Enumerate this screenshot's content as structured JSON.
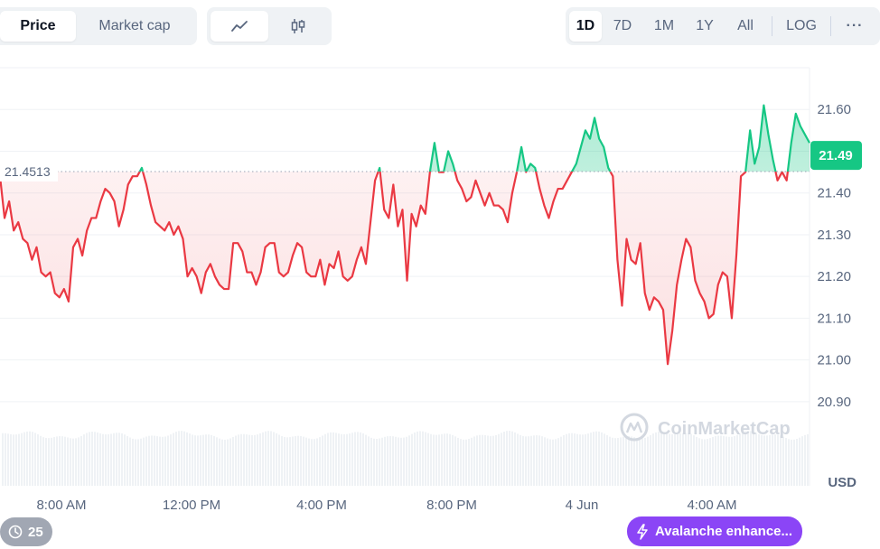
{
  "toolbar": {
    "metric_tabs": [
      {
        "label": "Price",
        "active": true
      },
      {
        "label": "Market cap",
        "active": false
      }
    ],
    "chart_type_icons": [
      {
        "icon": "line-chart-icon",
        "active": true
      },
      {
        "icon": "candlestick-icon",
        "active": false
      }
    ],
    "ranges": [
      {
        "label": "1D",
        "active": true
      },
      {
        "label": "7D",
        "active": false
      },
      {
        "label": "1M",
        "active": false
      },
      {
        "label": "1Y",
        "active": false
      },
      {
        "label": "All",
        "active": false
      }
    ],
    "log_label": "LOG",
    "more_label": "···"
  },
  "chart_data": {
    "type": "area",
    "title": "",
    "xlabel": "",
    "ylabel": "USD",
    "ylim": [
      20.85,
      21.7
    ],
    "y_ticks": [
      "21.60",
      "21.50",
      "21.40",
      "21.30",
      "21.20",
      "21.10",
      "21.00",
      "20.90"
    ],
    "x_ticks": [
      "8:00 AM",
      "12:00 PM",
      "4:00 PM",
      "8:00 PM",
      "4 Jun",
      "4:00 AM"
    ],
    "reference_price": 21.4513,
    "reference_label": "21.4513",
    "current_price": 21.49,
    "current_label": "21.49",
    "colors": {
      "up": "#16c784",
      "down": "#ea3943"
    },
    "watermark": "CoinMarketCap",
    "series": [
      {
        "values": [
          21.44,
          21.34,
          21.38,
          21.31,
          21.33,
          21.29,
          21.28,
          21.24,
          21.27,
          21.21,
          21.2,
          21.21,
          21.16,
          21.15,
          21.17,
          21.14,
          21.27,
          21.29,
          21.25,
          21.31,
          21.34,
          21.34,
          21.38,
          21.41,
          21.4,
          21.38,
          21.32,
          21.36,
          21.42,
          21.44,
          21.44,
          21.46,
          21.42,
          21.37,
          21.33,
          21.32,
          21.31,
          21.33,
          21.3,
          21.32,
          21.29,
          21.2,
          21.22,
          21.2,
          21.16,
          21.21,
          21.23,
          21.2,
          21.18,
          21.17,
          21.17,
          21.28,
          21.28,
          21.26,
          21.21,
          21.21,
          21.18,
          21.21,
          21.27,
          21.28,
          21.28,
          21.21,
          21.2,
          21.21,
          21.25,
          21.28,
          21.27,
          21.21,
          21.2,
          21.2,
          21.24,
          21.18,
          21.23,
          21.22,
          21.26,
          21.2,
          21.19,
          21.2,
          21.24,
          21.27,
          21.23,
          21.33,
          21.43,
          21.46,
          21.36,
          21.34,
          21.42,
          21.32,
          21.36,
          21.19,
          21.35,
          21.32,
          21.37,
          21.35,
          21.45,
          21.52,
          21.45,
          21.45,
          21.5,
          21.47,
          21.43,
          21.41,
          21.38,
          21.39,
          21.43,
          21.4,
          21.37,
          21.4,
          21.37,
          21.37,
          21.36,
          21.33,
          21.4,
          21.45,
          21.51,
          21.45,
          21.47,
          21.46,
          21.41,
          21.37,
          21.34,
          21.38,
          21.41,
          21.41,
          21.43,
          21.45,
          21.47,
          21.51,
          21.55,
          21.53,
          21.58,
          21.53,
          21.51,
          21.46,
          21.44,
          21.24,
          21.13,
          21.29,
          21.24,
          21.23,
          21.28,
          21.16,
          21.12,
          21.15,
          21.14,
          21.12,
          20.99,
          21.07,
          21.18,
          21.24,
          21.29,
          21.27,
          21.19,
          21.16,
          21.14,
          21.1,
          21.11,
          21.18,
          21.21,
          21.2,
          21.1,
          21.25,
          21.44,
          21.45,
          21.55,
          21.47,
          21.51,
          21.61,
          21.54,
          21.48,
          21.43,
          21.45,
          21.43,
          21.52,
          21.59,
          21.56,
          21.54,
          21.52
        ]
      }
    ]
  },
  "footer": {
    "history_badge": "25",
    "notice_label": "Avalanche enhance..."
  }
}
